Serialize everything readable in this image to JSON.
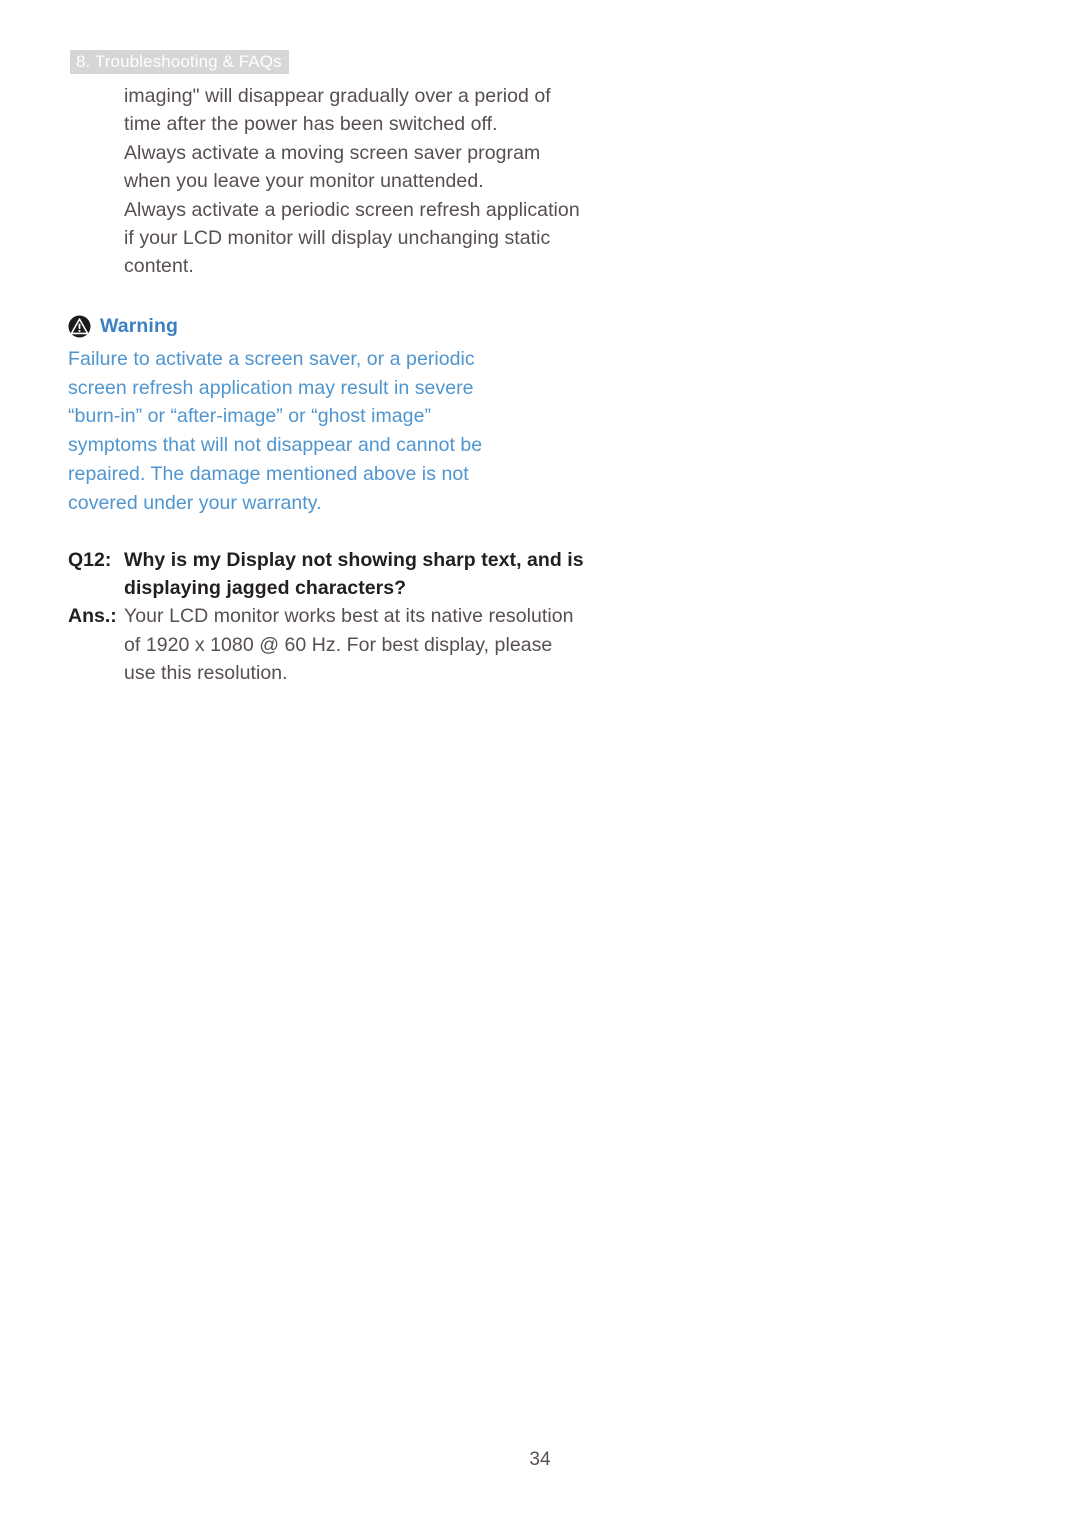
{
  "header": {
    "label": "8. Troubleshooting & FAQs",
    "background_color": "#d6d6d6",
    "text_color": "#ffffff"
  },
  "body": {
    "paragraphs": [
      "imaging\" will disappear gradually over a period of time after the power has been switched off.",
      "Always activate a moving screen saver program when you leave your monitor unattended.",
      "Always activate a periodic screen refresh application if your LCD monitor will display unchanging static content."
    ]
  },
  "warning": {
    "icon": "warning-triangle-icon",
    "title": "Warning",
    "title_color": "#3c80c2",
    "text_color": "#4f95cf",
    "text": "Failure to activate a screen saver, or a periodic screen refresh application may result in severe “burn-in” or “after-image” or “ghost image” symptoms  that will not disappear and cannot be repaired. The damage mentioned above is not covered under your warranty."
  },
  "qa": {
    "question_label": "Q12:",
    "question_text": "Why is my Display not showing sharp text, and is displaying jagged characters?",
    "answer_label": "Ans.:",
    "answer_text": "Your LCD monitor works best at its native resolution of 1920 x 1080 @ 60 Hz. For best display, please use this resolution."
  },
  "footer": {
    "page_number": "34"
  }
}
